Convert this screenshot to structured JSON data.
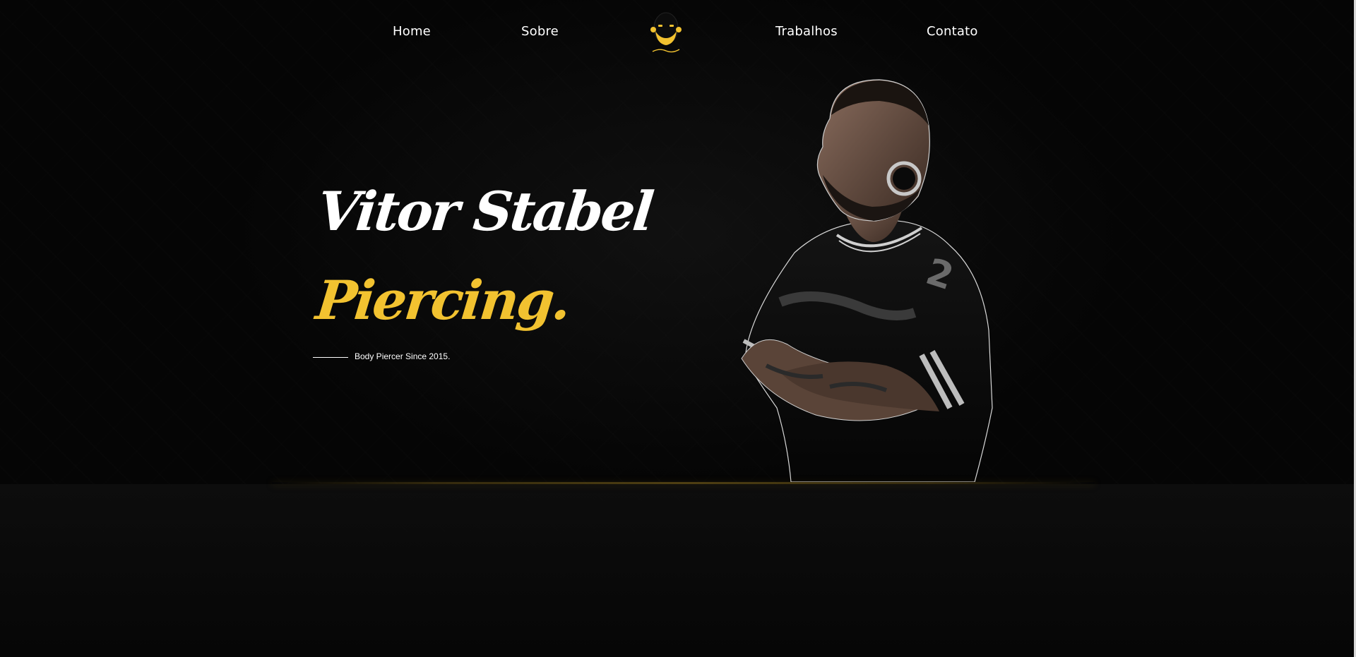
{
  "nav": {
    "home": "Home",
    "sobre": "Sobre",
    "logo_alt": "Stabel Piercer",
    "trabalhos": "Trabalhos",
    "contato": "Contato"
  },
  "hero": {
    "name": "Vitor Stabel",
    "subtitle": "Piercing.",
    "tagline": "Body Piercer Since 2015."
  },
  "colors": {
    "background": "#050505",
    "accent": "#f2c230",
    "text": "#ffffff"
  }
}
